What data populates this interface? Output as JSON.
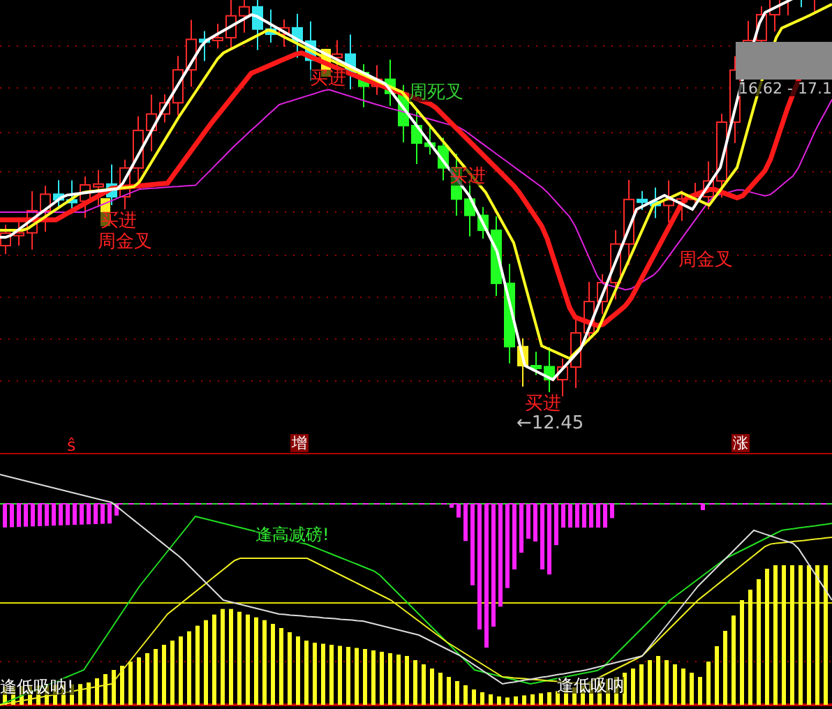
{
  "price_chart": {
    "range_label": "16.62 - 17.1",
    "labels": [
      {
        "text": "买进",
        "color": "#ff2020"
      },
      {
        "text": "周金叉",
        "color": "#ff2020"
      },
      {
        "text": "买进",
        "color": "#ff2020"
      },
      {
        "text": "周死叉",
        "color": "#33cc33"
      },
      {
        "text": "买进",
        "color": "#ff2020"
      },
      {
        "text": "买进",
        "color": "#ff2020"
      },
      {
        "text": "←12.45",
        "color": "#c0c0c0"
      },
      {
        "text": "周金叉",
        "color": "#ff2020"
      }
    ]
  },
  "markers": [
    {
      "text": "ŝ",
      "kind": "plain"
    },
    {
      "text": "增",
      "kind": "boxed"
    },
    {
      "text": "涨",
      "kind": "boxed"
    }
  ],
  "indicator_chart": {
    "labels": [
      {
        "text": "逢高减磅!",
        "color": "#33ee33"
      },
      {
        "text": "逢低吸呐!",
        "color": "#ffffff"
      },
      {
        "text": "逢低吸呐",
        "color": "#ffffff"
      }
    ]
  }
}
